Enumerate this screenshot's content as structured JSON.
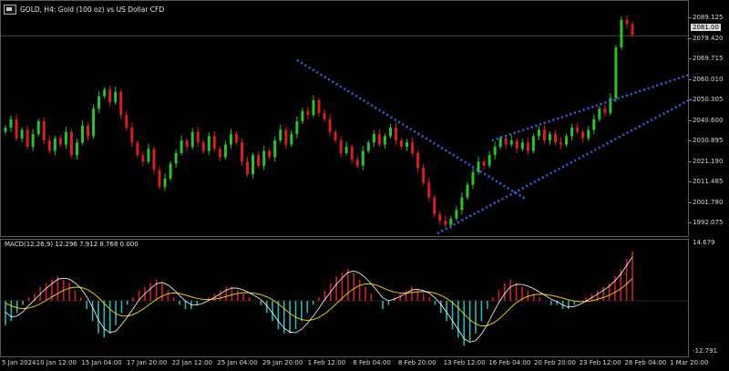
{
  "header": {
    "symbol_title": "GOLD, H4:  Gold (100 oz) vs US Dollar CFD",
    "macd_title": "MACD(12,26,9) 12.296 7.912 8.768 0.000"
  },
  "price_axis": {
    "labels": [
      "2089.125",
      "2079.420",
      "2069.715",
      "2060.010",
      "2050.305",
      "2040.600",
      "2030.895",
      "2021.190",
      "2011.485",
      "2001.780",
      "1992.075"
    ],
    "current_price": "2081.00"
  },
  "macd_axis": {
    "top": "14.679",
    "bottom": "-12.791"
  },
  "time_axis": {
    "labels": [
      "5 Jan 2024",
      "10 Jan 12:00",
      "15 Jan 04:00",
      "17 Jan 20:00",
      "22 Jan 12:00",
      "25 Jan 04:00",
      "29 Jan 20:00",
      "1 Feb 12:00",
      "6 Feb 04:00",
      "8 Feb 20:00",
      "13 Feb 12:00",
      "16 Feb 04:00",
      "20 Feb 20:00",
      "23 Feb 12:00",
      "28 Feb 04:00",
      "1 Mar 20:00"
    ]
  },
  "colors": {
    "bull": "#2fbf2f",
    "bear": "#d62020",
    "trendline": "#3a5fe0",
    "macd_up": "#cc2222",
    "macd_down": "#2fb3b3",
    "macd_line": "#ffffff",
    "signal_line": "#e8c619"
  },
  "chart_data": {
    "type": "candlestick",
    "title": "GOLD, H4: Gold (100 oz) vs US Dollar CFD",
    "ylim": [
      1987,
      2094
    ],
    "closes": [
      2037,
      2041,
      2032,
      2036,
      2028,
      2034,
      2040,
      2031,
      2026,
      2032,
      2029,
      2035,
      2024,
      2030,
      2038,
      2033,
      2046,
      2052,
      2055,
      2049,
      2054,
      2043,
      2037,
      2030,
      2024,
      2021,
      2027,
      2017,
      2009,
      2013,
      2020,
      2025,
      2031,
      2028,
      2035,
      2030,
      2026,
      2033,
      2027,
      2023,
      2029,
      2034,
      2030,
      2021,
      2015,
      2024,
      2019,
      2026,
      2023,
      2031,
      2036,
      2029,
      2034,
      2040,
      2045,
      2043,
      2050,
      2044,
      2041,
      2035,
      2031,
      2025,
      2028,
      2022,
      2019,
      2026,
      2030,
      2034,
      2029,
      2033,
      2037,
      2031,
      2028,
      2030,
      2025,
      2018,
      2011,
      2004,
      1996,
      1993,
      1991,
      1994,
      1998,
      2004,
      2010,
      2016,
      2021,
      2019,
      2024,
      2028,
      2032,
      2029,
      2031,
      2027,
      2030,
      2026,
      2033,
      2036,
      2031,
      2034,
      2030,
      2029,
      2033,
      2037,
      2035,
      2032,
      2036,
      2041,
      2046,
      2044,
      2051,
      2075,
      2088,
      2086,
      2081
    ],
    "macd_hist": [
      -6,
      -5,
      -3,
      -1,
      1,
      2,
      4,
      5,
      6,
      7,
      6,
      5,
      3,
      1,
      -2,
      -5,
      -8,
      -9,
      -8,
      -6,
      -3,
      -1,
      1,
      3,
      4,
      5,
      6,
      5,
      3,
      1,
      -1,
      -2,
      -2,
      -1,
      0,
      1,
      2,
      3,
      4,
      4,
      3,
      2,
      1,
      0,
      -1,
      -3,
      -5,
      -7,
      -8,
      -8,
      -7,
      -5,
      -3,
      -1,
      1,
      3,
      5,
      7,
      8,
      9,
      8,
      6,
      4,
      2,
      0,
      -2,
      -1,
      1,
      2,
      3,
      4,
      3,
      2,
      1,
      -1,
      -3,
      -5,
      -7,
      -9,
      -11,
      -10,
      -8,
      -5,
      -2,
      1,
      3,
      5,
      6,
      5,
      4,
      3,
      2,
      1,
      0,
      -1,
      -1,
      -2,
      -2,
      -1,
      0,
      1,
      2,
      3,
      4,
      5,
      7,
      9,
      12,
      14
    ],
    "trendlines": [
      {
        "name": "downtrend",
        "from": [
          "1 Feb 12:00",
          2069
        ],
        "to": [
          "20 Feb 20:00",
          2003
        ]
      },
      {
        "name": "channel_upper",
        "from": [
          "20 Feb 04:00",
          2031
        ],
        "to": [
          "1 Mar 20:00",
          2062
        ]
      },
      {
        "name": "channel_lower",
        "from": [
          "13 Feb 12:00",
          1987
        ],
        "to": [
          "1 Mar 20:00",
          2050
        ]
      }
    ]
  }
}
